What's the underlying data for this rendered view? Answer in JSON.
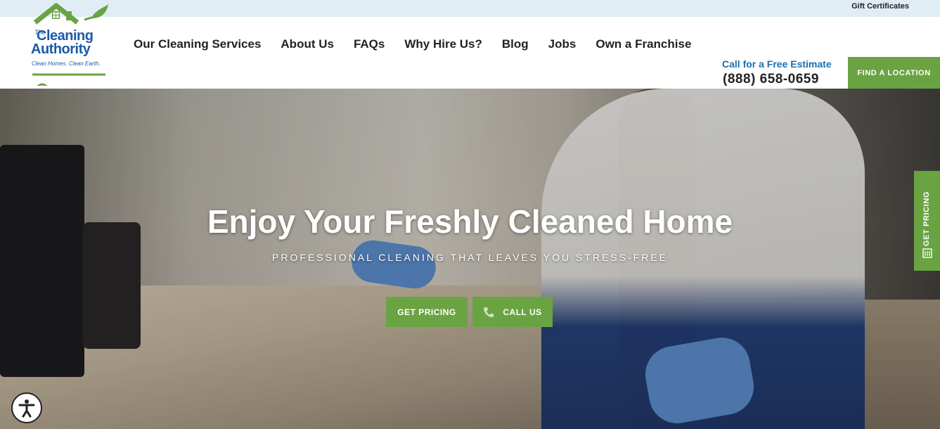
{
  "topbar": {
    "gift_link": "Gift Certificates"
  },
  "logo": {
    "line1": "The",
    "line2": "Cleaning",
    "line3": "Authority",
    "tagline": "Clean Homes. Clean Earth."
  },
  "nav": {
    "items": [
      "Our Cleaning Services",
      "About Us",
      "FAQs",
      "Why Hire Us?",
      "Blog",
      "Jobs",
      "Own a Franchise"
    ]
  },
  "contact": {
    "cta": "Call for a Free Estimate",
    "phone": "(888) 658-0659"
  },
  "find_location": "FIND A LOCATION",
  "hero": {
    "headline_pre": "Enjoy Your ",
    "headline_bold": "Freshly Cleaned",
    "headline_post": " Home",
    "subheadline": "PROFESSIONAL CLEANING THAT LEAVES YOU STRESS-FREE",
    "get_pricing": "GET PRICING",
    "call_us": "CALL US"
  },
  "side_tab": {
    "label": "GET PRICING"
  },
  "colors": {
    "brand_green": "#6aa342",
    "brand_blue": "#1a6fb0",
    "topbar": "#e0edf4"
  },
  "icons": [
    "logo-house-icon",
    "phone-icon",
    "calculator-icon",
    "accessibility-icon"
  ]
}
